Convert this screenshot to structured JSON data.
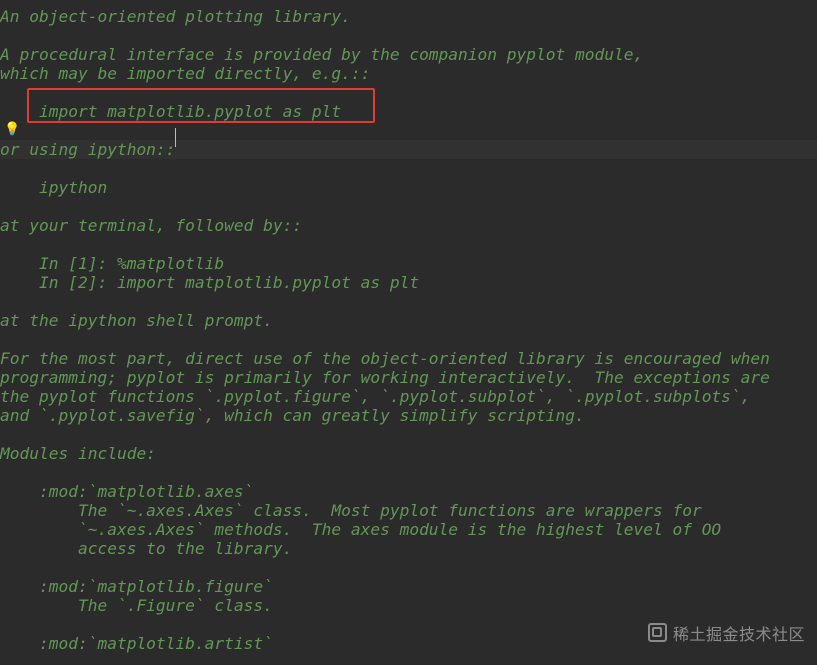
{
  "code": {
    "l0": "\"\"\"",
    "l1": "An object-oriented plotting library.",
    "l2": "",
    "l3": "A procedural interface is provided by the companion pyplot module,",
    "l4": "which may be imported directly, e.g.::",
    "l5": "",
    "l6": "    import matplotlib.pyplot as plt",
    "l7": "",
    "l8": "or using ipython::",
    "l9": "",
    "l10": "    ipython",
    "l11": "",
    "l12": "at your terminal, followed by::",
    "l13": "",
    "l14": "    In [1]: %matplotlib",
    "l15": "    In [2]: import matplotlib.pyplot as plt",
    "l16": "",
    "l17": "at the ipython shell prompt.",
    "l18": "",
    "l19": "For the most part, direct use of the object-oriented library is encouraged when",
    "l20": "programming; pyplot is primarily for working interactively.  The exceptions are",
    "l21": "the pyplot functions `.pyplot.figure`, `.pyplot.subplot`, `.pyplot.subplots`,",
    "l22": "and `.pyplot.savefig`, which can greatly simplify scripting.",
    "l23": "",
    "l24": "Modules include:",
    "l25": "",
    "l26": "    :mod:`matplotlib.axes`",
    "l27": "        The `~.axes.Axes` class.  Most pyplot functions are wrappers for",
    "l28": "        `~.axes.Axes` methods.  The axes module is the highest level of OO",
    "l29": "        access to the library.",
    "l30": "",
    "l31": "    :mod:`matplotlib.figure`",
    "l32": "        The `.Figure` class.",
    "l33": "",
    "l34": "    :mod:`matplotlib.artist`"
  },
  "bulb_glyph": "💡",
  "watermark_text": "稀土掘金技术社区"
}
